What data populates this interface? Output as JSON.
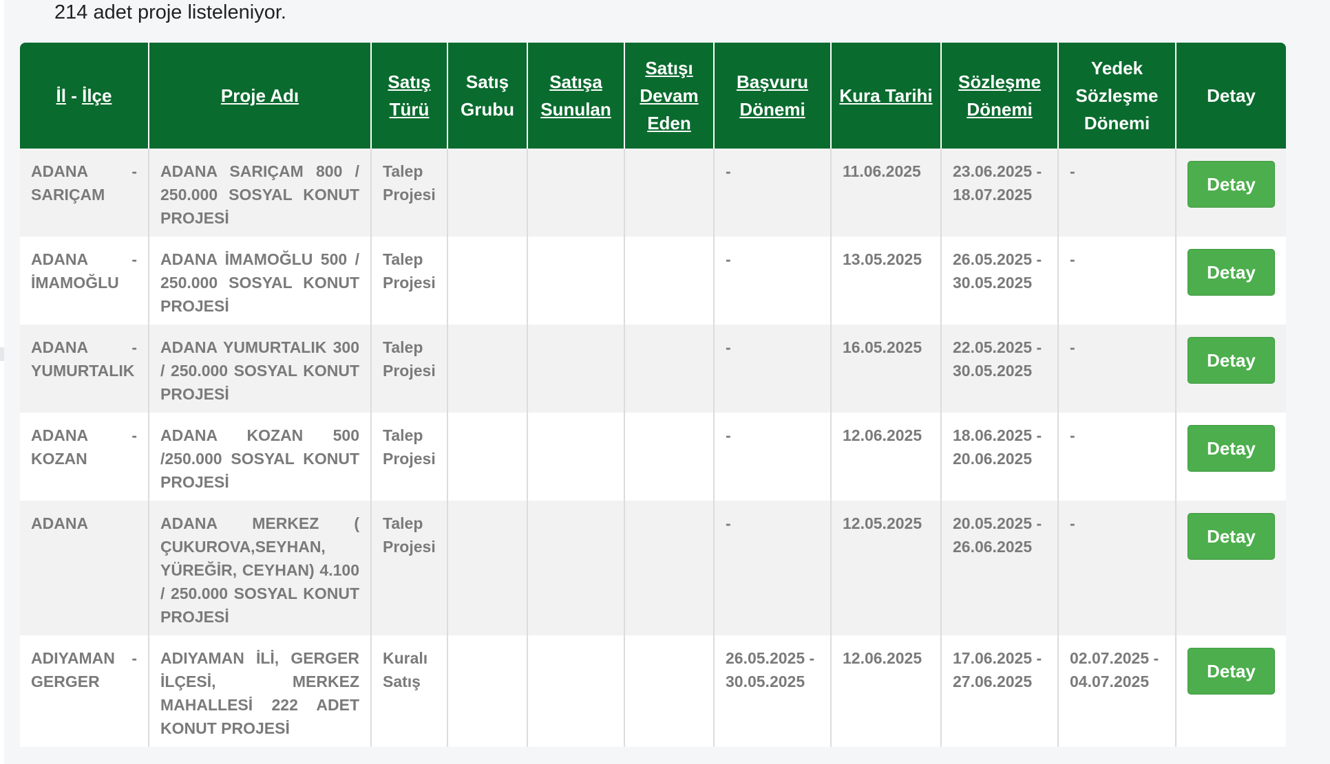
{
  "summary": {
    "count_text": "214 adet proje listeleniyor."
  },
  "columns": [
    {
      "line1": "İl",
      "sep": " - ",
      "line2": "İlçe",
      "linked": true
    },
    {
      "label": "Proje Adı",
      "linked": true
    },
    {
      "label": "Satış Türü",
      "linked": true
    },
    {
      "label": "Satış Grubu",
      "linked": false
    },
    {
      "label": "Satışa Sunulan",
      "linked": true
    },
    {
      "label": "Satışı Devam Eden",
      "linked": true
    },
    {
      "label": "Başvuru Dönemi",
      "linked": true
    },
    {
      "label": "Kura Tarihi",
      "linked": true
    },
    {
      "label": "Sözleşme Dönemi",
      "linked": true
    },
    {
      "label": "Yedek Sözleşme Dönemi",
      "linked": false
    },
    {
      "label": "Detay",
      "linked": false
    }
  ],
  "button_label": "Detay",
  "rows": [
    {
      "il_ilce": "ADANA - SARIÇAM",
      "proje": "ADANA SARIÇAM 800 / 250.000 SOSYAL KONUT PROJESİ",
      "satis_turu": "Talep Projesi",
      "satis_grubu": "",
      "satisa_sunulan": "",
      "satisi_devam": "",
      "basvuru": "-",
      "kura": "11.06.2025",
      "sozlesme": "23.06.2025 - 18.07.2025",
      "yedek": "-"
    },
    {
      "il_ilce": "ADANA - İMAMOĞLU",
      "proje": "ADANA İMAMOĞLU 500 / 250.000 SOSYAL KONUT PROJESİ",
      "satis_turu": "Talep Projesi",
      "satis_grubu": "",
      "satisa_sunulan": "",
      "satisi_devam": "",
      "basvuru": "-",
      "kura": "13.05.2025",
      "sozlesme": "26.05.2025 - 30.05.2025",
      "yedek": "-"
    },
    {
      "il_ilce": "ADANA - YUMURTALIK",
      "proje": "ADANA YUMURTALIK 300 / 250.000 SOSYAL KONUT PROJESİ",
      "satis_turu": "Talep Projesi",
      "satis_grubu": "",
      "satisa_sunulan": "",
      "satisi_devam": "",
      "basvuru": "-",
      "kura": "16.05.2025",
      "sozlesme": "22.05.2025 - 30.05.2025",
      "yedek": "-"
    },
    {
      "il_ilce": "ADANA - KOZAN",
      "proje": "ADANA KOZAN 500 /250.000 SOSYAL KONUT PROJESİ",
      "satis_turu": "Talep Projesi",
      "satis_grubu": "",
      "satisa_sunulan": "",
      "satisi_devam": "",
      "basvuru": "-",
      "kura": "12.06.2025",
      "sozlesme": "18.06.2025 - 20.06.2025",
      "yedek": "-"
    },
    {
      "il_ilce": "ADANA",
      "proje": "ADANA MERKEZ ( ÇUKUROVA,SEYHAN, YÜREĞİR, CEYHAN) 4.100 / 250.000 SOSYAL KONUT PROJESİ",
      "satis_turu": "Talep Projesi",
      "satis_grubu": "",
      "satisa_sunulan": "",
      "satisi_devam": "",
      "basvuru": "-",
      "kura": "12.05.2025",
      "sozlesme": "20.05.2025 - 26.06.2025",
      "yedek": "-"
    },
    {
      "il_ilce": "ADIYAMAN - GERGER",
      "proje": "ADIYAMAN İLİ, GERGER İLÇESİ, MERKEZ MAHALLESİ 222 ADET KONUT PROJESİ",
      "satis_turu": "Kuralı Satış",
      "satis_grubu": "",
      "satisa_sunulan": "",
      "satisi_devam": "",
      "basvuru": "26.05.2025 - 30.05.2025",
      "kura": "12.06.2025",
      "sozlesme": "17.06.2025 - 27.06.2025",
      "yedek": "02.07.2025 - 04.07.2025"
    }
  ]
}
